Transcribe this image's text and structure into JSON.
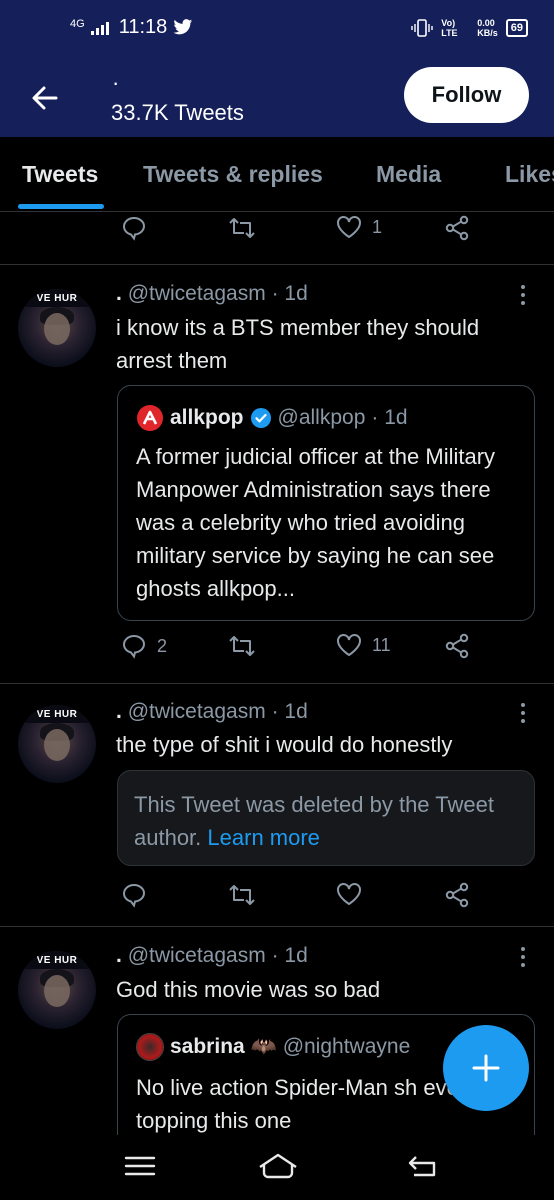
{
  "status_bar": {
    "network": "4G",
    "time": "11:18",
    "app_indicator": "twitter-icon",
    "volte": "Vo) LTE",
    "speed": "0.00",
    "speed_unit": "KB/s",
    "battery": "69"
  },
  "header": {
    "display_name": "·",
    "tweet_count": "33.7K Tweets",
    "follow_label": "Follow",
    "accent": "#15205a"
  },
  "tabs": [
    {
      "label": "Tweets",
      "active": true
    },
    {
      "label": "Tweets & replies",
      "active": false
    },
    {
      "label": "Media",
      "active": false
    },
    {
      "label": "Likes",
      "active": false
    }
  ],
  "top_actions": {
    "reply_count": "",
    "retweet_count": "",
    "like_count": "1"
  },
  "tweets": [
    {
      "name": ".",
      "handle": "@twicetagasm",
      "time": "· 1d",
      "avatar_text": "VE HUR",
      "text": "i know its a BTS member they should arrest them",
      "quote": {
        "name": "allkpop",
        "handle": "@allkpop",
        "time": "· 1d",
        "text": "A former judicial officer at the Military Manpower Administration says there was a celebrity who tried avoiding military service by saying he can see ghosts allkpop..."
      },
      "reply_count": "2",
      "retweet_count": "",
      "like_count": "11"
    },
    {
      "name": ".",
      "handle": "@twicetagasm",
      "time": "· 1d",
      "avatar_text": "VE HUR",
      "text": "the type of shit i would do honestly",
      "deleted_notice": "This Tweet was deleted by the Tweet author.",
      "deleted_link": "Learn more",
      "reply_count": "",
      "retweet_count": "",
      "like_count": ""
    },
    {
      "name": ".",
      "handle": "@twicetagasm",
      "time": "· 1d",
      "avatar_text": "VE HUR",
      "text": "God this movie was so bad",
      "quote": {
        "name": "sabrina 🦇",
        "handle": "@nightwayne",
        "text": "No live action Spider-Man sh ever topping this one"
      }
    }
  ],
  "fab_label": "+",
  "colors": {
    "accent": "#1d9bf0",
    "background": "#000000",
    "muted": "#8b98a5",
    "verified": "#1d9bf0",
    "allkpop_red": "#e0262b"
  }
}
